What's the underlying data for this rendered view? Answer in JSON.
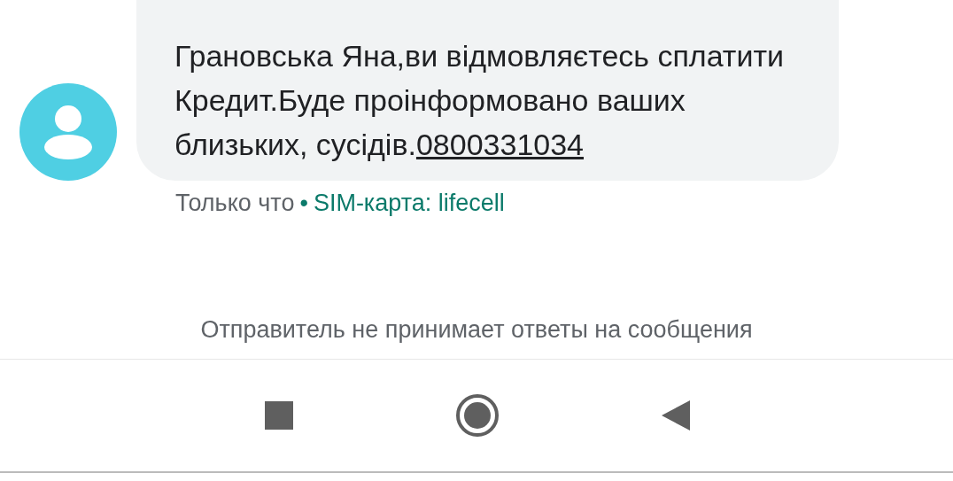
{
  "message": {
    "text": "Грановська Яна,ви відмовляєтесь сплатити Кредит.Буде проінформовано ваших близьких, сусідів.",
    "link": "0800331034"
  },
  "meta": {
    "time": "Только что",
    "separator": "•",
    "sim": "SIM-карта: lifecell"
  },
  "notice": "Отправитель не принимает ответы на сообщения"
}
